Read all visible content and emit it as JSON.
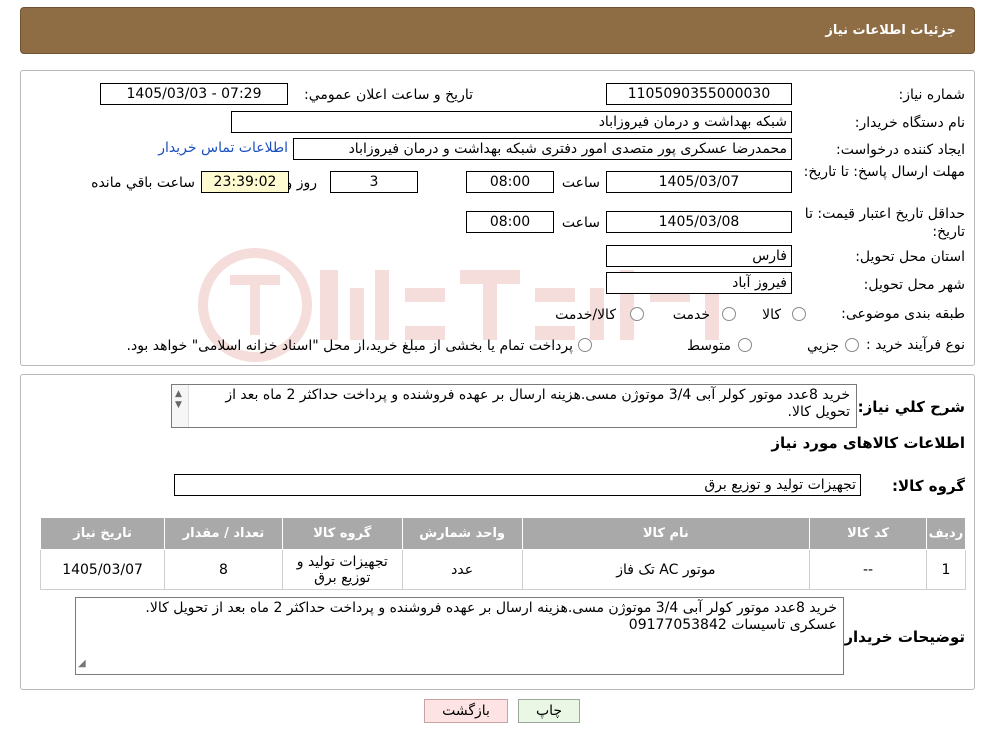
{
  "header": {
    "title": "جزئیات اطلاعات نیاز"
  },
  "fields": {
    "need_number_label": "شماره نیاز:",
    "need_number": "1105090355000030",
    "announce_label": "تاریخ و ساعت اعلان عمومي:",
    "announce_value": "1405/03/03 - 07:29",
    "buyer_org_label": "نام دستگاه خریدار:",
    "buyer_org": "شبکه بهداشت و درمان فیروزاباد",
    "creator_label": "ایجاد کننده درخواست:",
    "creator": "محمدرضا عسکری پور متصدی امور دفتری شبکه بهداشت و درمان فیروزاباد",
    "contact_link": "اطلاعات تماس خریدار",
    "deadline_label": "مهلت ارسال پاسخ: تا تاریخ:",
    "deadline_date": "1405/03/07",
    "time_label": "ساعت",
    "deadline_time": "08:00",
    "days_value": "3",
    "days_label": "روز و",
    "remaining_time": "23:39:02",
    "remaining_label": "ساعت باقي مانده",
    "validity_label": "حداقل تاریخ اعتبار قیمت: تا تاریخ:",
    "validity_date": "1405/03/08",
    "validity_time": "08:00",
    "province_label": "استان محل تحویل:",
    "province": "فارس",
    "city_label": "شهر محل تحویل:",
    "city": "فیروز آباد",
    "category_label": "طبقه بندی موضوعی:",
    "category_options": [
      "کالا",
      "خدمت",
      "کالا/خدمت"
    ],
    "process_label": "نوع فرآیند خرید :",
    "process_options": [
      "جزيي",
      "متوسط"
    ],
    "process_note": "پرداخت تمام یا بخشی از مبلغ خرید،از محل \"اسناد خزانه اسلامی\" خواهد بود."
  },
  "summary": {
    "label": "شرح کلي نياز:",
    "text": "خرید 8عدد موتور کولر آبی 3/4 موتوژن مسی.هزینه ارسال بر عهده فروشنده و پرداخت حداکثر 2 ماه بعد از تحویل کالا."
  },
  "goods": {
    "title": "اطلاعات کالاهای مورد نياز",
    "group_label": "گروه کالا:",
    "group_value": "تجهیزات تولید و توزیع برق",
    "columns": [
      "رديف",
      "کد کالا",
      "نام کالا",
      "واحد شمارش",
      "گروه کالا",
      "تعداد / مقدار",
      "تاریخ نیاز"
    ],
    "rows": [
      {
        "index": "1",
        "code": "--",
        "name": "موتور AC تک فاز",
        "unit": "عدد",
        "group": "تجهیزات تولید و توزیع برق",
        "qty": "8",
        "date": "1405/03/07"
      }
    ]
  },
  "buyer_notes": {
    "label": "توضيحات خريدار:",
    "line1": "خرید 8عدد موتور کولر آبی 3/4 موتوژن مسی.هزینه ارسال بر عهده فروشنده و پرداخت حداکثر 2 ماه بعد از تحویل کالا.",
    "line2": "عسکری تاسیسات 09177053842"
  },
  "buttons": {
    "print": "چاپ",
    "back": "بازگشت"
  },
  "colors": {
    "header": "#8e6c44",
    "table_header": "#a9a9a9",
    "print_bg": "#eaf7e4",
    "back_bg": "#fde3e3"
  }
}
